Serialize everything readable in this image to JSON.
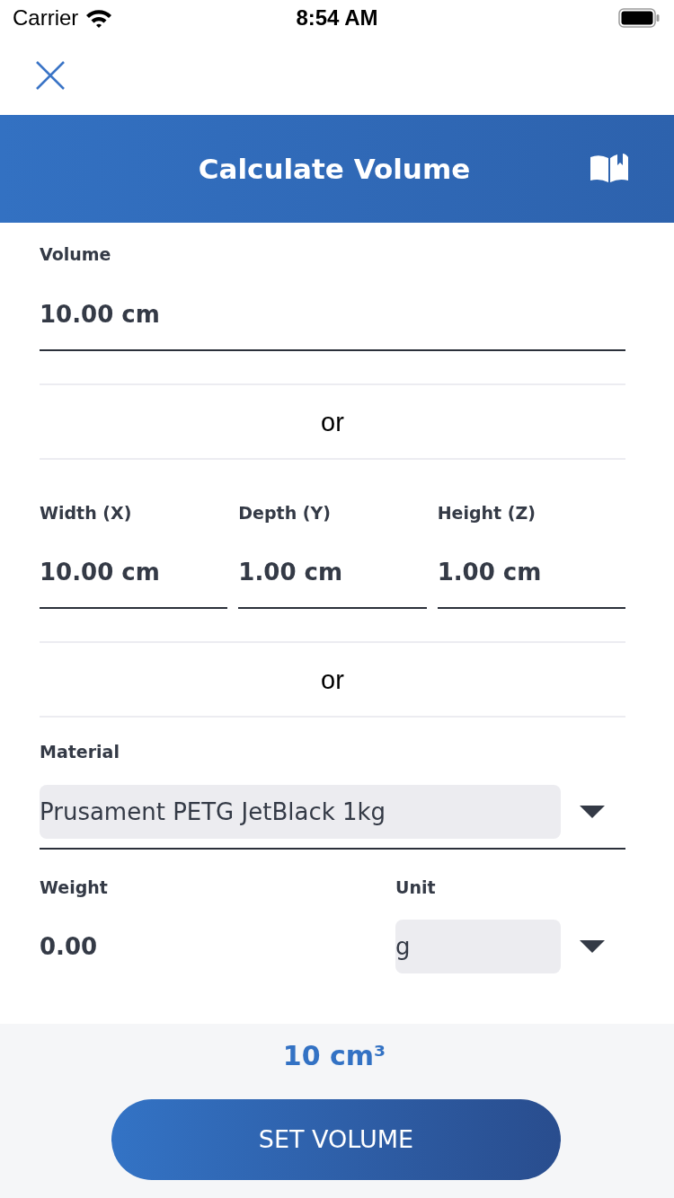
{
  "status_bar": {
    "carrier": "Carrier",
    "time": "8:54 AM"
  },
  "header": {
    "title": "Calculate Volume"
  },
  "form": [
    {
      "kind": "field",
      "label": "Volume",
      "value": "10.00 cm"
    },
    {
      "kind": "divider",
      "text": "or"
    },
    {
      "kind": "dimensions",
      "fields": [
        {
          "label": "Width (X)",
          "value": "10.00 cm"
        },
        {
          "label": "Depth (Y)",
          "value": "1.00 cm"
        },
        {
          "label": "Height (Z)",
          "value": "1.00 cm"
        }
      ]
    },
    {
      "kind": "divider",
      "text": "or"
    },
    {
      "kind": "select",
      "label": "Material",
      "value": "Prusament PETG JetBlack 1kg"
    },
    {
      "kind": "weight",
      "label": "Weight",
      "value": "0.00",
      "unit": {
        "label": "Unit",
        "value": "g"
      }
    }
  ],
  "footer": {
    "result": "10 cm³",
    "button": "SET VOLUME"
  }
}
